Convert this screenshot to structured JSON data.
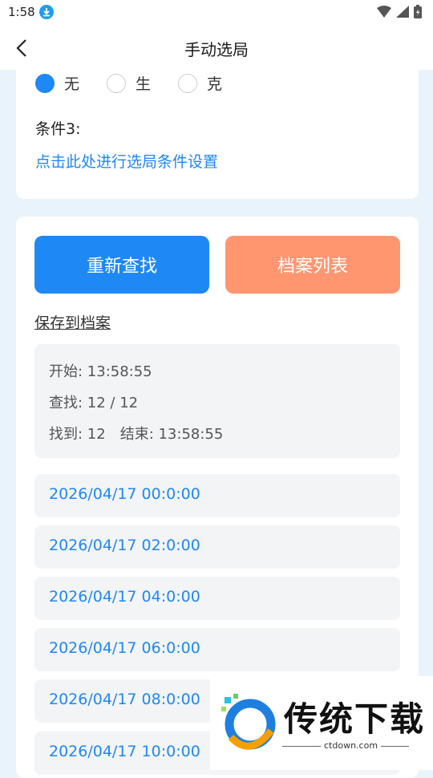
{
  "status": {
    "time": "1:58"
  },
  "appbar": {
    "title": "手动选局"
  },
  "filter": {
    "options": [
      "无",
      "生",
      "克"
    ],
    "selected": "无",
    "condition3_label": "条件3:",
    "condition3_link": "点击此处进行选局条件设置"
  },
  "actions": {
    "search_again": "重新查找",
    "archive_list": "档案列表",
    "save_to_archive": "保存到档案"
  },
  "summary": {
    "start": "开始: 13:58:55",
    "search": "查找: 12 / 12",
    "found_end": "找到: 12　结束: 13:58:55"
  },
  "results": [
    "2026/04/17 00:0:00",
    "2026/04/17 02:0:00",
    "2026/04/17 04:0:00",
    "2026/04/17 06:0:00",
    "2026/04/17 08:0:00",
    "2026/04/17 10:0:00"
  ],
  "watermark": {
    "brand": "传统下载",
    "url": "ctdown.com"
  },
  "colors": {
    "accent": "#1e88f5",
    "secondary_button": "#ff9670",
    "background": "#e9f3fc"
  }
}
